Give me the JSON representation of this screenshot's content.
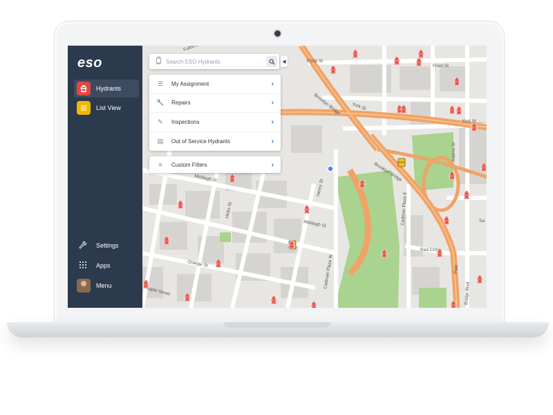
{
  "app": {
    "logo": "eso"
  },
  "sidebar": {
    "items": [
      {
        "label": "Hydrants",
        "icon": "hydrant-icon",
        "color": "#e9453f",
        "active": true
      },
      {
        "label": "List View",
        "icon": "list-icon",
        "color": "#f2b705",
        "active": false
      }
    ],
    "bottom": [
      {
        "label": "Settings",
        "icon": "wrench-icon"
      },
      {
        "label": "Apps",
        "icon": "apps-grid-icon"
      },
      {
        "label": "Menu",
        "icon": "avatar"
      }
    ]
  },
  "search": {
    "placeholder": "Search ESO Hydrants"
  },
  "menu": {
    "items": [
      {
        "label": "My Assignment",
        "icon": "checklist-icon"
      },
      {
        "label": "Repairs",
        "icon": "wrench-icon"
      },
      {
        "label": "Inspections",
        "icon": "clipboard-icon"
      },
      {
        "label": "Out of Service Hydrants",
        "icon": "out-of-service-icon"
      }
    ],
    "filters": {
      "label": "Custom Filters",
      "icon": "sliders-icon"
    }
  },
  "map": {
    "streets": {
      "front_st_1": "Front St",
      "front_st_2": "Front St",
      "york_st_1": "York St",
      "york_st_2": "York St",
      "adams_st": "Adams St",
      "brooklyn_bridge_1": "Brooklyn Bridge",
      "brooklyn_bridge_2": "Brooklyn Bridge",
      "cadman_plaza_e": "Cadman Plaza E",
      "cadman_plaza_w": "Cadman Plaza W",
      "henry_st": "Henry St",
      "middagh_st_1": "Middagh St",
      "middagh_st_2": "Middagh St",
      "hicks_st": "Hicks St",
      "orange_st": "Orange St",
      "apple_street": "Apple Street",
      "red_cross": "Red Cross",
      "bridge_blvd": "Bridge Blvd",
      "fulton_st": "Fulton St",
      "sands": "Sa",
      "pole": "Pole",
      "out_of_service": "OUT"
    },
    "colors": {
      "highway": "#f0a366",
      "park": "#a9d38f",
      "block": "#d6d4d0",
      "road": "#ffffff",
      "hydrant": "#e53b30",
      "warning": "#f2c21b",
      "user": "#4a86e8"
    }
  }
}
